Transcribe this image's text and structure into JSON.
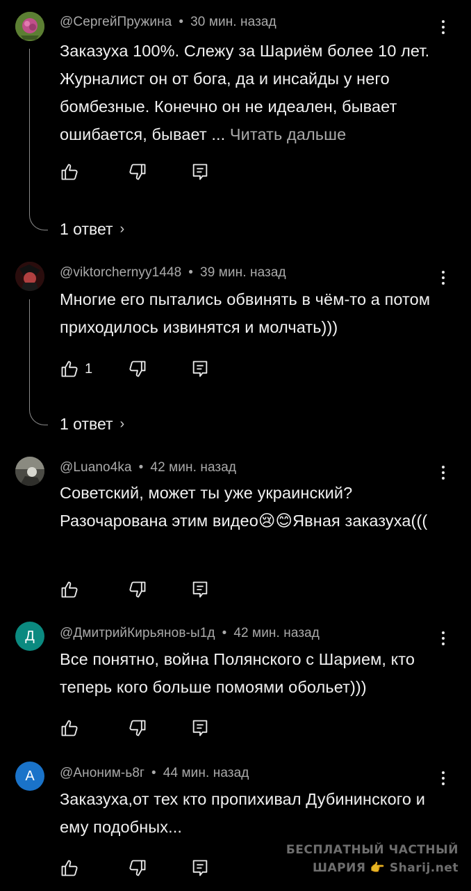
{
  "comments": [
    {
      "author": "@СергейПружина",
      "time": "30 мин. назад",
      "text": "Заказуха 100%. Слежу за Шариём более 10 лет. Журналист он от бога, да и инсайды у него бомбезные. Конечно он не идеален, бывает ошибается, бывает ... ",
      "read_more": "Читать дальше",
      "like_count": "",
      "replies": "1 ответ",
      "avatar": {
        "type": "image",
        "color": "#6b8f3a"
      }
    },
    {
      "author": "@viktorchernyy1448",
      "time": "39 мин. назад",
      "text": "Многие его пытались обвинять в чём-то а потом приходилось извинятся и молчать)))",
      "like_count": "1",
      "replies": "1 ответ",
      "avatar": {
        "type": "image",
        "color": "#3a1414"
      }
    },
    {
      "author": "@Luano4ka",
      "time": "42 мин. назад",
      "text": "Советский, может ты уже украинский? Разочарована этим видео😢😊Явная заказуха(((",
      "like_count": "",
      "replies": "",
      "avatar": {
        "type": "image",
        "color": "#5a5a52"
      }
    },
    {
      "author": "@ДмитрийКирьянов-ы1д",
      "time": "42 мин. назад",
      "text": "Все понятно, война Полянского с Шарием, кто теперь кого больше помоями обольет)))",
      "like_count": "",
      "replies": "",
      "avatar": {
        "type": "letter",
        "letter": "Д",
        "color": "#0b8a80"
      }
    },
    {
      "author": "@Аноним-ь8г",
      "time": "44 мин. назад",
      "text": "Заказуха,от тех кто пропихивал Дубининского и ему подобных...",
      "like_count": "",
      "replies": "",
      "avatar": {
        "type": "letter",
        "letter": "А",
        "color": "#1a73c9"
      }
    }
  ],
  "icons": {
    "like": "thumbs-up-icon",
    "dislike": "thumbs-down-icon",
    "reply": "reply-icon",
    "menu": "more-vert-icon",
    "chevron": "chevron-right-icon"
  },
  "watermark": {
    "line1": "БЕСПЛАТНЫЙ ЧАСТНЫЙ",
    "line2": "ШАРИЯ 👉 Sharij.net"
  }
}
